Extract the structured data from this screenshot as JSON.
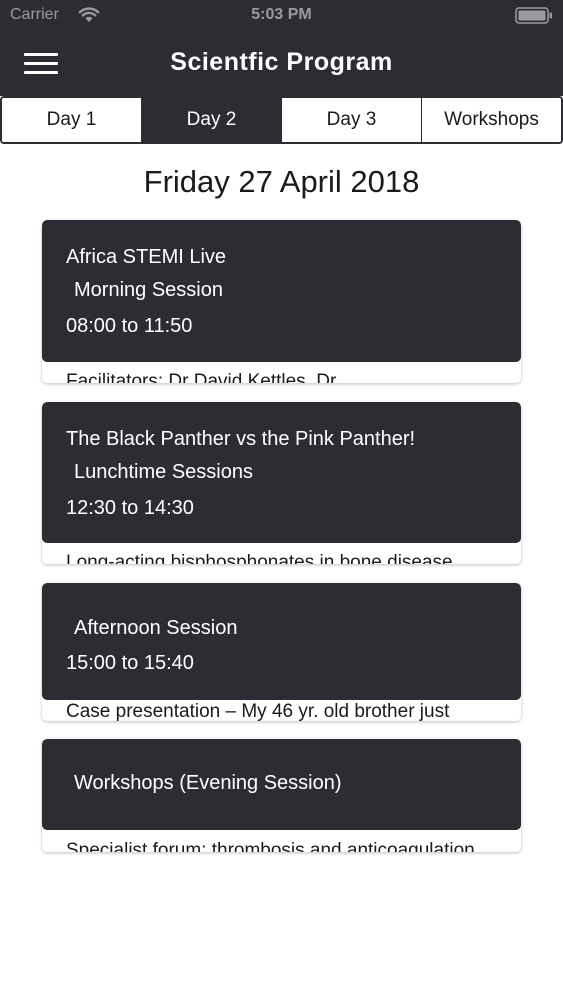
{
  "status_bar": {
    "carrier": "Carrier",
    "time": "5:03 PM"
  },
  "nav": {
    "title": "Scientfic Program"
  },
  "tabs": [
    {
      "label": "Day 1",
      "active": false
    },
    {
      "label": "Day 2",
      "active": true
    },
    {
      "label": "Day 3",
      "active": false
    },
    {
      "label": "Workshops",
      "active": false
    }
  ],
  "date_heading": "Friday 27 April 2018",
  "sessions": [
    {
      "title": "Africa STEMI Live",
      "session": "Morning Session",
      "time": "08:00 to 11:50",
      "preview": "Facilitators: Dr David Kettles, Dr"
    },
    {
      "title": "The Black Panther vs the Pink Panther!",
      "session": "Lunchtime Sessions",
      "time": "12:30 to 14:30",
      "preview": "Long-acting bisphosphonates in bone disease"
    },
    {
      "title": "",
      "session": "Afternoon Session",
      "time": "15:00 to 15:40",
      "preview": "Case presentation – My 46 yr. old brother just"
    },
    {
      "title": "",
      "session": "Workshops (Evening Session)",
      "time": "",
      "preview": "Specialist forum: thrombosis and anticoagulation"
    }
  ],
  "colors": {
    "header_bg": "#2d2c33",
    "header_text": "#ffffff",
    "status_text": "#9b9aa1",
    "page_bg": "#ffffff",
    "body_text": "#1a1a1a"
  }
}
